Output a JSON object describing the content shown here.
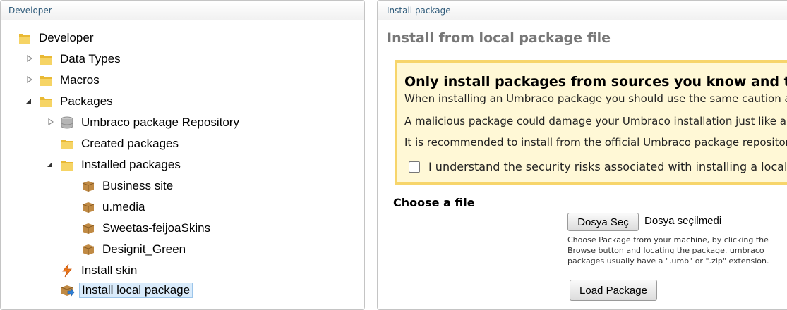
{
  "left_panel": {
    "header": "Developer",
    "tree": [
      {
        "label": "Developer",
        "icon": "folder-icon",
        "toggle": ""
      },
      {
        "label": "Data Types",
        "icon": "folder-icon",
        "toggle": "collapsed"
      },
      {
        "label": "Macros",
        "icon": "folder-icon",
        "toggle": "collapsed"
      },
      {
        "label": "Packages",
        "icon": "folder-icon",
        "toggle": "expanded"
      },
      {
        "label": "Umbraco package Repository",
        "icon": "database-icon",
        "toggle": "collapsed"
      },
      {
        "label": "Created packages",
        "icon": "folder-icon",
        "toggle": ""
      },
      {
        "label": "Installed packages",
        "icon": "folder-icon",
        "toggle": "expanded"
      },
      {
        "label": "Business site",
        "icon": "package-icon",
        "toggle": ""
      },
      {
        "label": "u.media",
        "icon": "package-icon",
        "toggle": ""
      },
      {
        "label": "Sweetas-feijoaSkins",
        "icon": "package-icon",
        "toggle": ""
      },
      {
        "label": "Designit_Green",
        "icon": "package-icon",
        "toggle": ""
      },
      {
        "label": "Install skin",
        "icon": "lightning-icon",
        "toggle": ""
      },
      {
        "label": "Install local package",
        "icon": "install-package-icon",
        "toggle": "",
        "selected": true
      }
    ]
  },
  "right_panel": {
    "header": "Install package",
    "title": "Install from local package file",
    "warning": {
      "title": "Only install packages from sources you know and trust!",
      "line1": "When installing an Umbraco package you should use the same caution as when you install an application on your computer.",
      "line2": "A malicious package could damage your Umbraco installation just like a malicious application can damage your computer.",
      "line3": "It is recommended to install from the official Umbraco package repository or a source you trust.",
      "accept_label": "I understand the security risks associated with installing a local package"
    },
    "choose_file": {
      "title": "Choose a file",
      "button": "Dosya Seç",
      "status": "Dosya seçilmedi",
      "hint": "Choose Package from your machine, by clicking the Browse button and locating the package. umbraco packages usually have a \".umb\" or \".zip\" extension."
    },
    "load_button": "Load Package"
  },
  "colors": {
    "header_text": "#2f5b7a",
    "warning_bg": "#fff8d6",
    "warning_border": "#f7d56b",
    "selection_bg": "#d9ebfb"
  }
}
